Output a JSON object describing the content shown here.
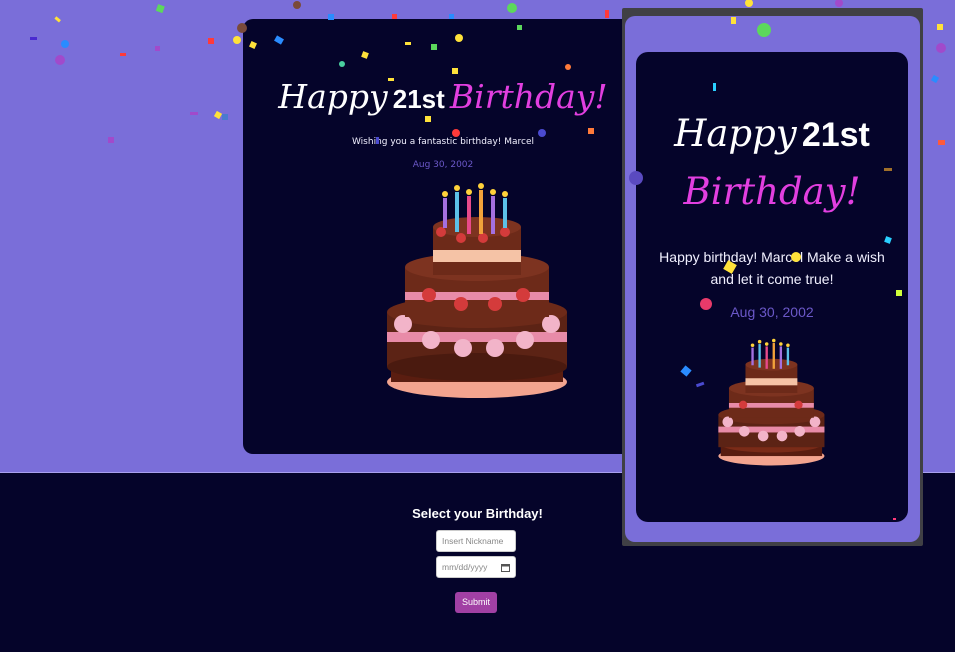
{
  "desktop_card": {
    "title_happy": "Happy",
    "title_age": "21st",
    "title_birthday": "Birthday!",
    "message": "Wishing you a fantastic birthday! Marcel",
    "date": "Aug 30, 2002"
  },
  "phone_card": {
    "title_happy": "Happy",
    "title_age": "21st",
    "title_birthday": "Birthday!",
    "message_line1": "Happy birthday! Marcel Make a wish",
    "message_line2": "and let it come true!",
    "date": "Aug 30, 2002"
  },
  "form": {
    "title": "Select your Birthday!",
    "nickname_placeholder": "Insert Nickname",
    "date_placeholder": "mm/dd/yyyy",
    "submit_label": "Submit"
  },
  "icons": {
    "calendar": "calendar-icon",
    "cake": "birthday-cake-icon",
    "confetti": "confetti-icon"
  },
  "colors": {
    "background_band": "#7a6ed9",
    "card_background": "#05042a",
    "accent_pink": "#e23fe0",
    "date_purple": "#6b58c8",
    "submit_button": "#a140a4"
  }
}
